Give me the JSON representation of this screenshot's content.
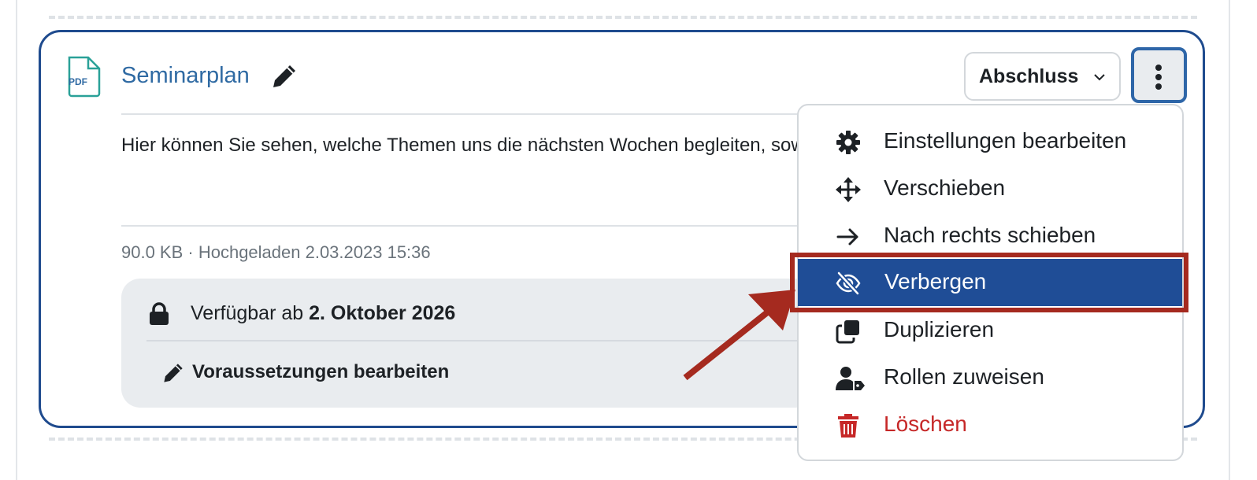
{
  "activity": {
    "title": "Seminarplan",
    "file_type_label": "PDF",
    "description": "Hier können Sie sehen, welche Themen uns die nächsten Wochen begleiten, sowie Informationen zur zu erbringenden Prüfungsleistung.",
    "meta": "90.0 KB · Hochgeladen 2.03.2023 15:36"
  },
  "restrictions": {
    "availability_prefix": "Verfügbar ab ",
    "availability_date": "2. Oktober 2026",
    "edit_conditions_label": "Voraussetzungen bearbeiten"
  },
  "toolbar": {
    "completion_label": "Abschluss"
  },
  "menu": {
    "items": [
      {
        "label": "Einstellungen bearbeiten",
        "icon": "gear-icon"
      },
      {
        "label": "Verschieben",
        "icon": "move-icon"
      },
      {
        "label": "Nach rechts schieben",
        "icon": "arrow-right-icon"
      },
      {
        "label": "Verbergen",
        "icon": "eye-slash-icon",
        "active": true
      },
      {
        "label": "Duplizieren",
        "icon": "copy-icon"
      },
      {
        "label": "Rollen zuweisen",
        "icon": "user-tag-icon"
      },
      {
        "label": "Löschen",
        "icon": "trash-icon",
        "danger": true
      }
    ]
  },
  "colors": {
    "link": "#2f6aa3",
    "card_border": "#1f4b8e",
    "menu_active_bg": "#1f4d96",
    "danger": "#c62828",
    "annotation": "#a52a1f"
  }
}
